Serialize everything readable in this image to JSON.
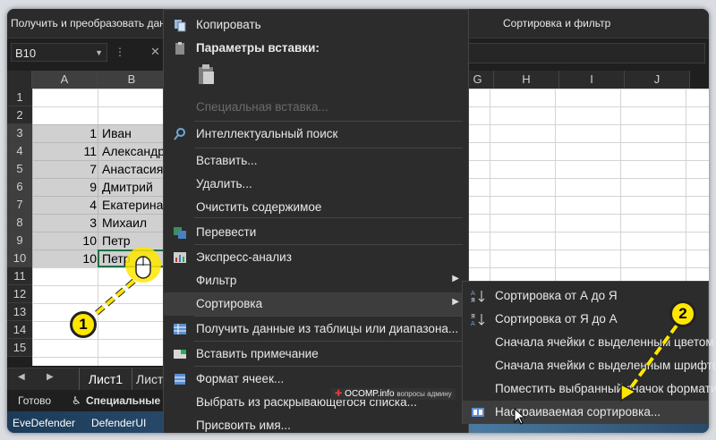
{
  "ribbon": {
    "left_group": "Получить и преобразовать данн",
    "right_group": "Сортировка и фильтр"
  },
  "namebox": {
    "value": "B10"
  },
  "columns": [
    "A",
    "B",
    "G",
    "H",
    "I",
    "J"
  ],
  "rows": [
    {
      "num": "1",
      "a": "",
      "b": ""
    },
    {
      "num": "2",
      "a": "",
      "b": ""
    },
    {
      "num": "3",
      "a": "1",
      "b": "Иван"
    },
    {
      "num": "4",
      "a": "11",
      "b": "Александр"
    },
    {
      "num": "5",
      "a": "7",
      "b": "Анастасия"
    },
    {
      "num": "6",
      "a": "9",
      "b": "Дмитрий"
    },
    {
      "num": "7",
      "a": "4",
      "b": "Екатерина"
    },
    {
      "num": "8",
      "a": "3",
      "b": "Михаил"
    },
    {
      "num": "9",
      "a": "10",
      "b": "Петр"
    },
    {
      "num": "10",
      "a": "10",
      "b": "Петр"
    },
    {
      "num": "11",
      "a": "",
      "b": ""
    },
    {
      "num": "12",
      "a": "",
      "b": ""
    },
    {
      "num": "13",
      "a": "",
      "b": ""
    },
    {
      "num": "14",
      "a": "",
      "b": ""
    },
    {
      "num": "15",
      "a": "",
      "b": ""
    }
  ],
  "sheet_tabs": [
    "Лист1",
    "Лист"
  ],
  "status": {
    "ready": "Готово",
    "accessibility": "Специальные в"
  },
  "taskbar": [
    "EveDefender",
    "DefenderUI"
  ],
  "context_menu": {
    "copy": "Копировать",
    "paste_options": "Параметры вставки:",
    "paste_special": "Специальная вставка...",
    "smart_lookup": "Интеллектуальный поиск",
    "insert": "Вставить...",
    "delete": "Удалить...",
    "clear": "Очистить содержимое",
    "translate": "Перевести",
    "quick_analysis": "Экспресс-анализ",
    "filter": "Фильтр",
    "sort": "Сортировка",
    "get_data": "Получить данные из таблицы или диапазона...",
    "insert_note": "Вставить примечание",
    "format_cells": "Формат ячеек...",
    "pick_from_list": "Выбрать из раскрывающегося списка...",
    "define_name": "Присвоить имя..."
  },
  "sort_submenu": {
    "asc": "Сортировка от А до Я",
    "desc": "Сортировка от Я до А",
    "sel_cell_color": "Сначала ячейки с выделенным цветом",
    "sel_font_color": "Сначала ячейки с выделенным шрифтом",
    "put_icon": "Поместить выбранный значок форматир",
    "custom": "Настраиваемая сортировка..."
  },
  "annotations": {
    "badge1": "1",
    "badge2": "2"
  },
  "watermark": {
    "brand": "OCOMP.info",
    "tag": "вопросы админу"
  },
  "colors": {
    "accent_yellow": "#ffe600",
    "menu_bg": "#2c2c2c",
    "menu_hover": "#3d3d3d",
    "selection_border": "#1e7145"
  }
}
